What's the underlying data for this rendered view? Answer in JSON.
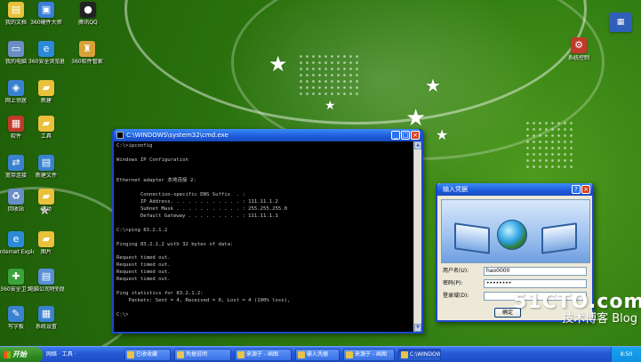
{
  "desktop_icons": [
    {
      "label": "我的文档",
      "icon": "my-documents-icon",
      "color": "#e9c13a",
      "glyph": "▤"
    },
    {
      "label": "360硬件大师",
      "icon": "hardware-master-icon",
      "color": "#3b7fd8",
      "glyph": "▣"
    },
    {
      "label": "腾讯QQ",
      "icon": "qq-icon",
      "color": "#222222",
      "glyph": "●"
    },
    {
      "label": "我的电脑",
      "icon": "my-computer-icon",
      "color": "#6a8fc4",
      "glyph": "▭"
    },
    {
      "label": "360安全浏览器",
      "icon": "browser-icon",
      "color": "#2d8ad8",
      "glyph": "e"
    },
    {
      "label": "360软件管家",
      "icon": "software-manager-icon",
      "color": "#d8a23a",
      "glyph": "♜"
    },
    {
      "label": "网上邻居",
      "icon": "network-places-icon",
      "color": "#3a82d0",
      "glyph": "◈"
    },
    {
      "label": "新建",
      "icon": "folder-icon",
      "color": "#e9c13a",
      "glyph": "▰"
    },
    {
      "label": "软件",
      "icon": "software-icon",
      "color": "#c0392b",
      "glyph": "▦"
    },
    {
      "label": "工具",
      "icon": "tools-folder-icon",
      "color": "#e9c13a",
      "glyph": "▰"
    },
    {
      "label": "宽带连接",
      "icon": "broadband-icon",
      "color": "#3a82d0",
      "glyph": "⇄"
    },
    {
      "label": "新建文件",
      "icon": "new-file-icon",
      "color": "#3a82d0",
      "glyph": "▤"
    },
    {
      "label": "回收站",
      "icon": "recycle-bin-icon",
      "color": "#6a8fc4",
      "glyph": "♻"
    },
    {
      "label": "驱动",
      "icon": "driver-folder-icon",
      "color": "#e9c13a",
      "glyph": "▰"
    },
    {
      "label": "Internet Explorer",
      "icon": "internet-explorer-icon",
      "color": "#2d8ad8",
      "glyph": "e"
    },
    {
      "label": "图片",
      "icon": "pictures-folder-icon",
      "color": "#e9c13a",
      "glyph": "▰"
    },
    {
      "label": "360安全卫士",
      "icon": "security-guard-icon",
      "color": "#3aa33a",
      "glyph": "✚"
    },
    {
      "label": "电脑公司特别版",
      "icon": "document-icon",
      "color": "#5a8fd6",
      "glyph": "▤"
    },
    {
      "label": "写字板",
      "icon": "wordpad-icon",
      "color": "#3a82d0",
      "glyph": "✎"
    },
    {
      "label": "系统设置",
      "icon": "system-settings-icon",
      "color": "#3a82d0",
      "glyph": "▦"
    }
  ],
  "right_icons": [
    {
      "label": "系统控制",
      "icon": "control-panel-icon",
      "color": "#c0392b",
      "glyph": "⚙"
    }
  ],
  "cmd_window": {
    "title": "C:\\WINDOWS\\system32\\cmd.exe",
    "lines": [
      "C:\\>ipconfig",
      "",
      "Windows IP Configuration",
      "",
      "",
      "Ethernet adapter 本地连接 2:",
      "",
      "        Connection-specific DNS Suffix  . :",
      "        IP Address. . . . . . . . . . . . : 111.11.1.2",
      "        Subnet Mask . . . . . . . . . . . : 255.255.255.0",
      "        Default Gateway . . . . . . . . . : 111.11.1.1",
      "",
      "C:\\>ping 83.2.1.2",
      "",
      "Pinging 83.2.1.2 with 32 bytes of data:",
      "",
      "Request timed out.",
      "Request timed out.",
      "Request timed out.",
      "Request timed out.",
      "",
      "Ping statistics for 83.2.1.2:",
      "    Packets: Sent = 4, Received = 0, Lost = 4 (100% loss),",
      "",
      "C:\\>"
    ]
  },
  "dialog": {
    "title": "输入凭据",
    "username_label": "用户名(U):",
    "username_value": "hao0000",
    "password_label": "密码(P):",
    "password_value": "••••••••",
    "domain_label": "登录域(D):",
    "domain_value": "",
    "ok_label": "确定"
  },
  "watermark": {
    "site": "51CTO.com",
    "blog": "技术博客 Blog"
  },
  "taskbar": {
    "start_label": "开始",
    "quick_launch": "网络 · 工具 ·",
    "items": [
      {
        "label": "已收收藏"
      },
      {
        "label": "凭据说明"
      },
      {
        "label": "来源于 - 画图"
      },
      {
        "label": "输入凭据"
      },
      {
        "label": "来源于 - 画图"
      },
      {
        "label": "C:\\WINDOWS"
      }
    ],
    "clock": "8:50"
  },
  "colors": {
    "desktop_green": "#2f7a10",
    "titlebar_blue": "#1d5ad8",
    "taskbar_blue": "#2458d4",
    "start_green": "#2f8a23"
  }
}
